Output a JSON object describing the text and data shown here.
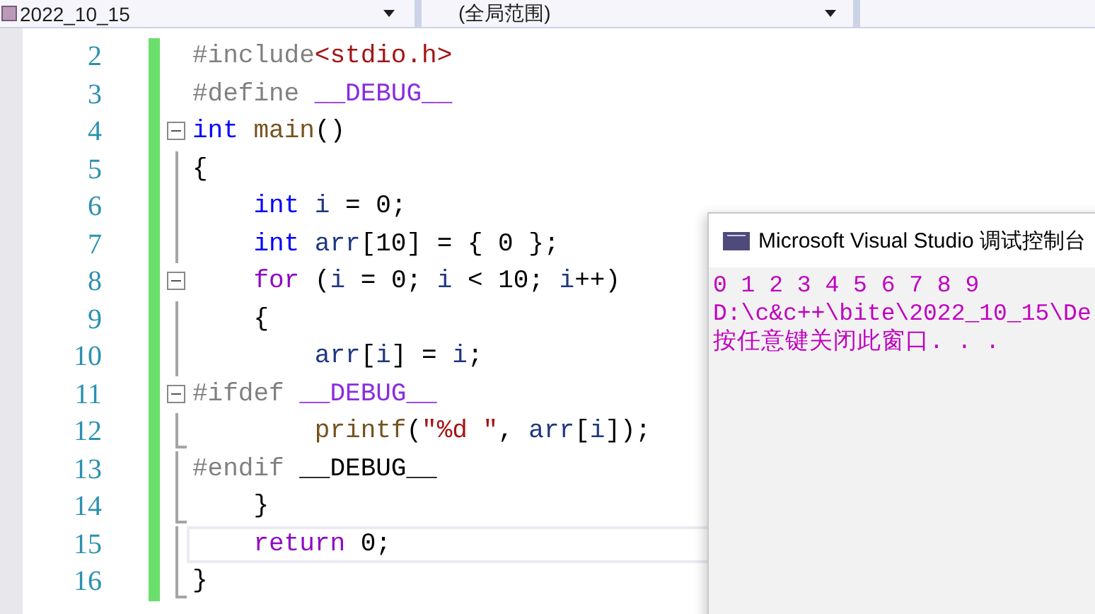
{
  "nav_bar": {
    "project": "2022_10_15",
    "scope": "(全局范围)"
  },
  "code_lines": [
    {
      "number": "2",
      "kind": "plain",
      "current": false,
      "tokens": [
        {
          "kind": "pp",
          "text": "#include"
        },
        {
          "kind": "path",
          "text": "<stdio.h>"
        }
      ]
    },
    {
      "number": "3",
      "kind": "plain",
      "current": false,
      "tokens": [
        {
          "kind": "pp",
          "text": "#define "
        },
        {
          "kind": "macro",
          "text": "__DEBUG__"
        }
      ]
    },
    {
      "number": "4",
      "kind": "start",
      "current": false,
      "tokens": [
        {
          "kind": "kw",
          "text": "int "
        },
        {
          "kind": "fn",
          "text": "main"
        },
        {
          "kind": "plain",
          "text": "()"
        }
      ]
    },
    {
      "number": "5",
      "kind": "inside",
      "current": false,
      "tokens": [
        {
          "kind": "plain",
          "text": "{"
        }
      ]
    },
    {
      "number": "6",
      "kind": "inside",
      "current": false,
      "tokens": [
        {
          "kind": "kw",
          "text": "    int "
        },
        {
          "kind": "var",
          "text": "i"
        },
        {
          "kind": "plain",
          "text": " = 0;"
        }
      ]
    },
    {
      "number": "7",
      "kind": "inside",
      "current": false,
      "tokens": [
        {
          "kind": "kw",
          "text": "    int "
        },
        {
          "kind": "var",
          "text": "arr"
        },
        {
          "kind": "plain",
          "text": "[10] = { 0 };"
        }
      ]
    },
    {
      "number": "8",
      "kind": "start",
      "current": false,
      "tokens": [
        {
          "kind": "ctrl",
          "text": "    for"
        },
        {
          "kind": "plain",
          "text": " ("
        },
        {
          "kind": "var",
          "text": "i"
        },
        {
          "kind": "plain",
          "text": " = 0; "
        },
        {
          "kind": "var",
          "text": "i"
        },
        {
          "kind": "plain",
          "text": " < 10; "
        },
        {
          "kind": "var",
          "text": "i"
        },
        {
          "kind": "plain",
          "text": "++)"
        }
      ]
    },
    {
      "number": "9",
      "kind": "inside",
      "current": false,
      "tokens": [
        {
          "kind": "plain",
          "text": "    {"
        }
      ]
    },
    {
      "number": "10",
      "kind": "inside",
      "current": false,
      "tokens": [
        {
          "kind": "var",
          "text": "        arr"
        },
        {
          "kind": "plain",
          "text": "["
        },
        {
          "kind": "var",
          "text": "i"
        },
        {
          "kind": "plain",
          "text": "] = "
        },
        {
          "kind": "var",
          "text": "i"
        },
        {
          "kind": "plain",
          "text": ";"
        }
      ]
    },
    {
      "number": "11",
      "kind": "start",
      "current": false,
      "tokens": [
        {
          "kind": "pp",
          "text": "#ifdef "
        },
        {
          "kind": "macro",
          "text": "__DEBUG__"
        }
      ]
    },
    {
      "number": "12",
      "kind": "end",
      "current": false,
      "tokens": [
        {
          "kind": "fn",
          "text": "        printf"
        },
        {
          "kind": "plain",
          "text": "("
        },
        {
          "kind": "str",
          "text": "\"%d \""
        },
        {
          "kind": "plain",
          "text": ", "
        },
        {
          "kind": "var",
          "text": "arr"
        },
        {
          "kind": "plain",
          "text": "["
        },
        {
          "kind": "var",
          "text": "i"
        },
        {
          "kind": "plain",
          "text": "]);"
        }
      ]
    },
    {
      "number": "13",
      "kind": "inside",
      "current": false,
      "tokens": [
        {
          "kind": "pp",
          "text": "#endif "
        },
        {
          "kind": "plain",
          "text": "__DEBUG__"
        }
      ]
    },
    {
      "number": "14",
      "kind": "end",
      "current": false,
      "tokens": [
        {
          "kind": "plain",
          "text": "    }"
        }
      ]
    },
    {
      "number": "15",
      "kind": "inside",
      "current": true,
      "tokens": [
        {
          "kind": "ctrl",
          "text": "    return"
        },
        {
          "kind": "plain",
          "text": " 0;"
        }
      ]
    },
    {
      "number": "16",
      "kind": "end",
      "current": false,
      "tokens": [
        {
          "kind": "plain",
          "text": "}"
        }
      ]
    }
  ],
  "console_window": {
    "title": "Microsoft Visual Studio 调试控制台",
    "lines": [
      "0 1 2 3 4 5 6 7 8 9",
      "D:\\c&c++\\bite\\2022_10_15\\De",
      "按任意键关闭此窗口. . ."
    ]
  }
}
